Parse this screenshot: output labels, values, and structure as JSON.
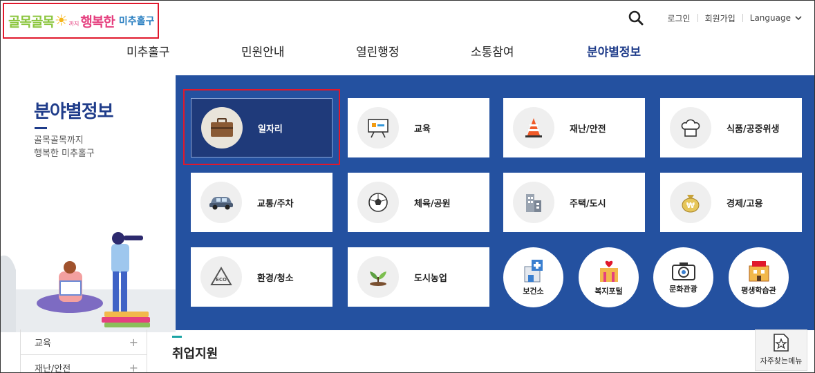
{
  "logo": {
    "part_a": "골목골목",
    "small": "까지",
    "part_b": "행복한",
    "part_c": "미추홀구"
  },
  "utility": {
    "login": "로그인",
    "signup": "회원가입",
    "language": "Language"
  },
  "gnb": {
    "items": [
      "미추홀구",
      "민원안내",
      "열린행정",
      "소통참여",
      "분야별정보"
    ],
    "active_index": 4
  },
  "lnb": {
    "title": "분야별정보",
    "sub_line1": "골목골목까지",
    "sub_line2": "행복한 미추홀구",
    "list": [
      "교육",
      "재난/안전"
    ]
  },
  "panel": {
    "cards": [
      {
        "label": "일자리",
        "icon": "briefcase-icon",
        "selected": true
      },
      {
        "label": "교육",
        "icon": "presentation-board-icon"
      },
      {
        "label": "재난/안전",
        "icon": "traffic-cone-icon"
      },
      {
        "label": "식품/공중위생",
        "icon": "chef-hat-icon"
      },
      {
        "label": "교통/주차",
        "icon": "car-icon"
      },
      {
        "label": "체육/공원",
        "icon": "soccer-ball-icon"
      },
      {
        "label": "주택/도시",
        "icon": "building-icon"
      },
      {
        "label": "경제/고용",
        "icon": "money-bag-icon"
      },
      {
        "label": "환경/청소",
        "icon": "recycle-eco-icon"
      },
      {
        "label": "도시농업",
        "icon": "sprout-icon"
      }
    ],
    "rounds": [
      {
        "label": "보건소",
        "icon": "hospital-icon"
      },
      {
        "label": "복지포털",
        "icon": "heart-house-icon"
      },
      {
        "label": "문화관광",
        "icon": "camera-icon"
      },
      {
        "label": "평생학습관",
        "icon": "school-icon"
      }
    ]
  },
  "content": {
    "title": "취업지원"
  },
  "faq": {
    "label": "자주찾는메뉴"
  },
  "colors": {
    "brand_blue": "#1f3c8a",
    "panel_blue": "#2451a0",
    "highlight_red": "#e0182c"
  }
}
